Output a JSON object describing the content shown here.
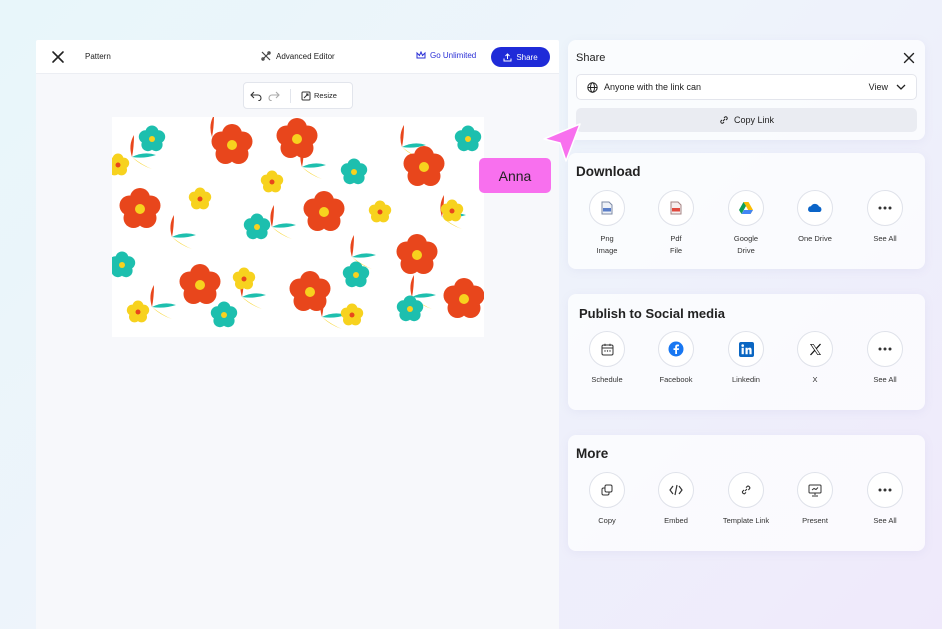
{
  "editor": {
    "doc_name": "Pattern",
    "advanced_editor": "Advanced Editor",
    "go_unlimited": "Go Unlimited",
    "share_label": "Share",
    "resize_label": "Resize"
  },
  "share": {
    "title": "Share",
    "access_text": "Anyone with the link can",
    "access_level": "View",
    "copy_link": "Copy Link"
  },
  "download": {
    "title": "Download",
    "items": [
      {
        "line1": "Png",
        "line2": "Image",
        "icon": "png-file-icon"
      },
      {
        "line1": "Pdf",
        "line2": "File",
        "icon": "pdf-file-icon"
      },
      {
        "line1": "Google",
        "line2": "Drive",
        "icon": "google-drive-icon"
      },
      {
        "line1": "One Drive",
        "line2": "",
        "icon": "onedrive-icon"
      },
      {
        "line1": "See All",
        "line2": "",
        "icon": "more-dots-icon"
      }
    ]
  },
  "social": {
    "title": "Publish to Social media",
    "items": [
      {
        "label": "Schedule",
        "icon": "calendar-icon"
      },
      {
        "label": "Facebook",
        "icon": "facebook-icon"
      },
      {
        "label": "Linkedin",
        "icon": "linkedin-icon"
      },
      {
        "label": "X",
        "icon": "x-logo-icon"
      },
      {
        "label": "See All",
        "icon": "more-dots-icon"
      }
    ]
  },
  "more": {
    "title": "More",
    "items": [
      {
        "label": "Copy",
        "icon": "copy-icon"
      },
      {
        "label": "Embed",
        "icon": "code-icon"
      },
      {
        "label": "Template Link",
        "icon": "link-icon"
      },
      {
        "label": "Present",
        "icon": "presentation-icon"
      },
      {
        "label": "See All",
        "icon": "more-dots-icon"
      }
    ]
  },
  "cursor": {
    "name": "Anna",
    "color": "#f870ee"
  },
  "colors": {
    "accent": "#1f2bd8",
    "flower_red": "#e8461c",
    "flower_teal": "#1dbfae",
    "flower_yellow": "#f7d21e"
  }
}
